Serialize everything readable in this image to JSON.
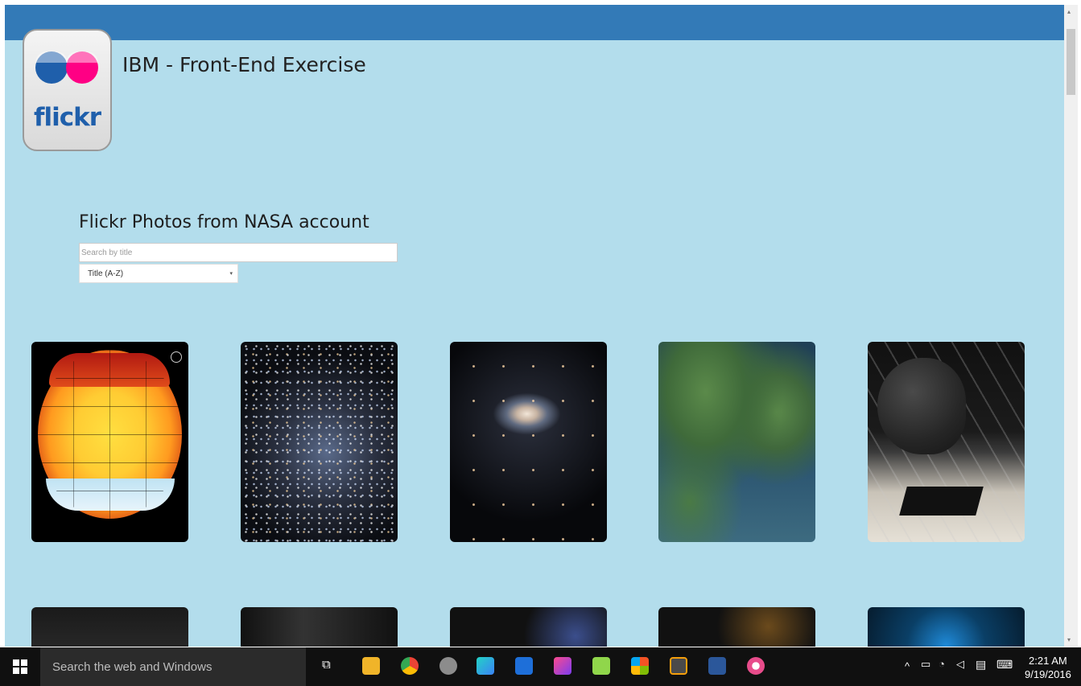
{
  "app": {
    "title": "IBM - Front-End Exercise",
    "logo_text": "flickr",
    "brand_colors": {
      "blue": "#1f5fab",
      "pink": "#ff0084",
      "topbar": "#337ab7",
      "background": "#b3ddec"
    }
  },
  "section": {
    "title": "Flickr Photos from NASA account"
  },
  "search": {
    "placeholder": "Search by title",
    "value": ""
  },
  "sort": {
    "selected": "Title (A-Z)",
    "arrow": "▾"
  },
  "photos": [
    {
      "name": "photo-global-temperature-map",
      "icon": "photo"
    },
    {
      "name": "photo-star-cluster",
      "icon": "photo"
    },
    {
      "name": "photo-galaxy",
      "icon": "photo"
    },
    {
      "name": "photo-coastline-satellite",
      "icon": "photo"
    },
    {
      "name": "photo-asteroid-stage",
      "icon": "photo"
    },
    {
      "name": "photo-row2-1",
      "icon": "photo"
    },
    {
      "name": "photo-row2-2",
      "icon": "photo"
    },
    {
      "name": "photo-row2-3",
      "icon": "photo"
    },
    {
      "name": "photo-row2-4",
      "icon": "photo"
    },
    {
      "name": "photo-row2-5",
      "icon": "photo"
    }
  ],
  "scrollbar": {
    "up_arrow": "▴",
    "down_arrow": "▾"
  },
  "taskbar": {
    "search_placeholder": "Search the web and Windows",
    "icons": [
      "task-view-icon",
      "file-explorer-icon",
      "chrome-icon",
      "snipping-tool-icon",
      "webstorm-icon",
      "teamviewer-icon",
      "intellij-icon",
      "notepad-plus-icon",
      "windows-store-icon",
      "sublime-icon",
      "word-icon",
      "itunes-icon"
    ],
    "tray": {
      "chevron": "^",
      "time": "2:21 AM",
      "date": "9/19/2016"
    }
  }
}
